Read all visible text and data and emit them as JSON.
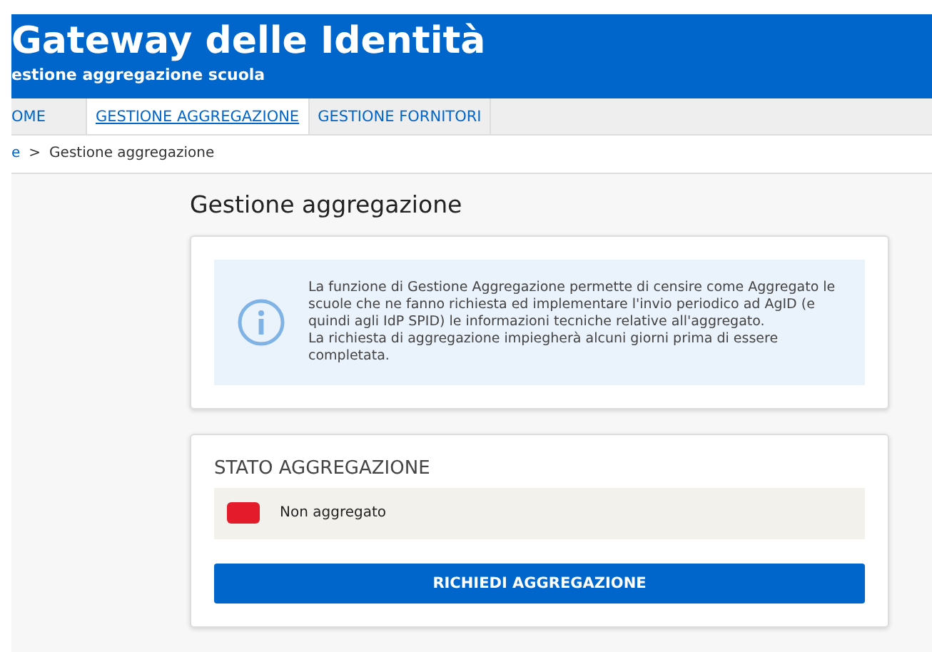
{
  "header": {
    "title": "Gateway delle Identità",
    "subtitle": "estione aggregazione scuola"
  },
  "nav": [
    {
      "label": "OME",
      "selected": false
    },
    {
      "label": "GESTIONE AGGREGAZIONE",
      "selected": true
    },
    {
      "label": "GESTIONE FORNITORI",
      "selected": false
    }
  ],
  "breadcrumb": {
    "link": "e",
    "separator": ">",
    "current": "Gestione aggregazione"
  },
  "page_title": "Gestione aggregazione",
  "info": {
    "lines": [
      "La funzione di Gestione Aggregazione permette di censire come Aggregato le scuole che ne fanno richiesta ed implementare l'invio periodico ad AgID (e quindi agli IdP SPID) le informazioni tecniche relative all'aggregato.",
      "La richiesta di aggregazione impiegherà alcuni giorni prima di essere completata."
    ]
  },
  "status": {
    "heading": "STATO AGGREGAZIONE",
    "label": "Non aggregato",
    "color": "#e31b2b"
  },
  "button": "RICHIEDI AGGREGAZIONE"
}
